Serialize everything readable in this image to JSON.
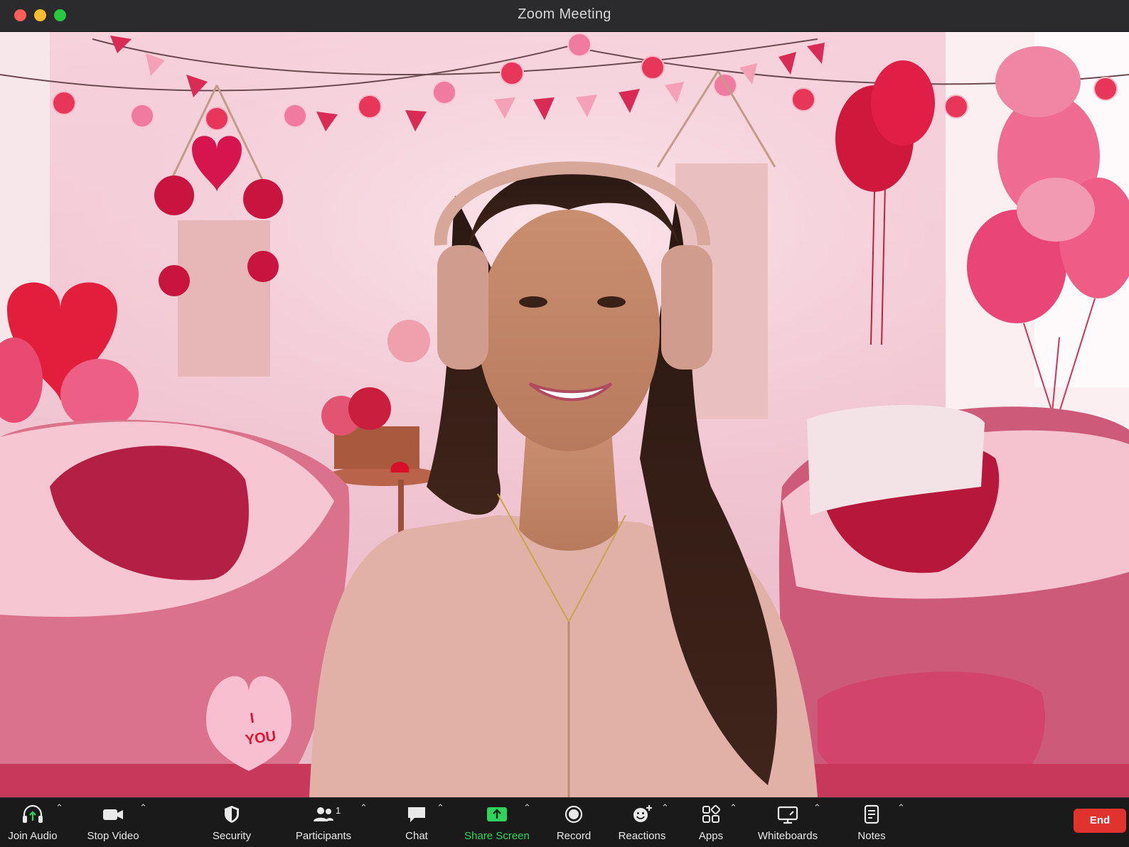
{
  "window": {
    "title": "Zoom Meeting"
  },
  "toolbar": {
    "join_audio": "Join Audio",
    "stop_video": "Stop Video",
    "security": "Security",
    "participants": "Participants",
    "participant_count": "1",
    "chat": "Chat",
    "share_screen": "Share Screen",
    "record": "Record",
    "reactions": "Reactions",
    "apps": "Apps",
    "whiteboards": "Whiteboards",
    "notes": "Notes",
    "end": "End"
  },
  "background": {
    "pillow_text_1": "I",
    "pillow_text_2": "YOU"
  },
  "colors": {
    "share_accent": "#2fd45d",
    "end_button": "#e0332d"
  }
}
